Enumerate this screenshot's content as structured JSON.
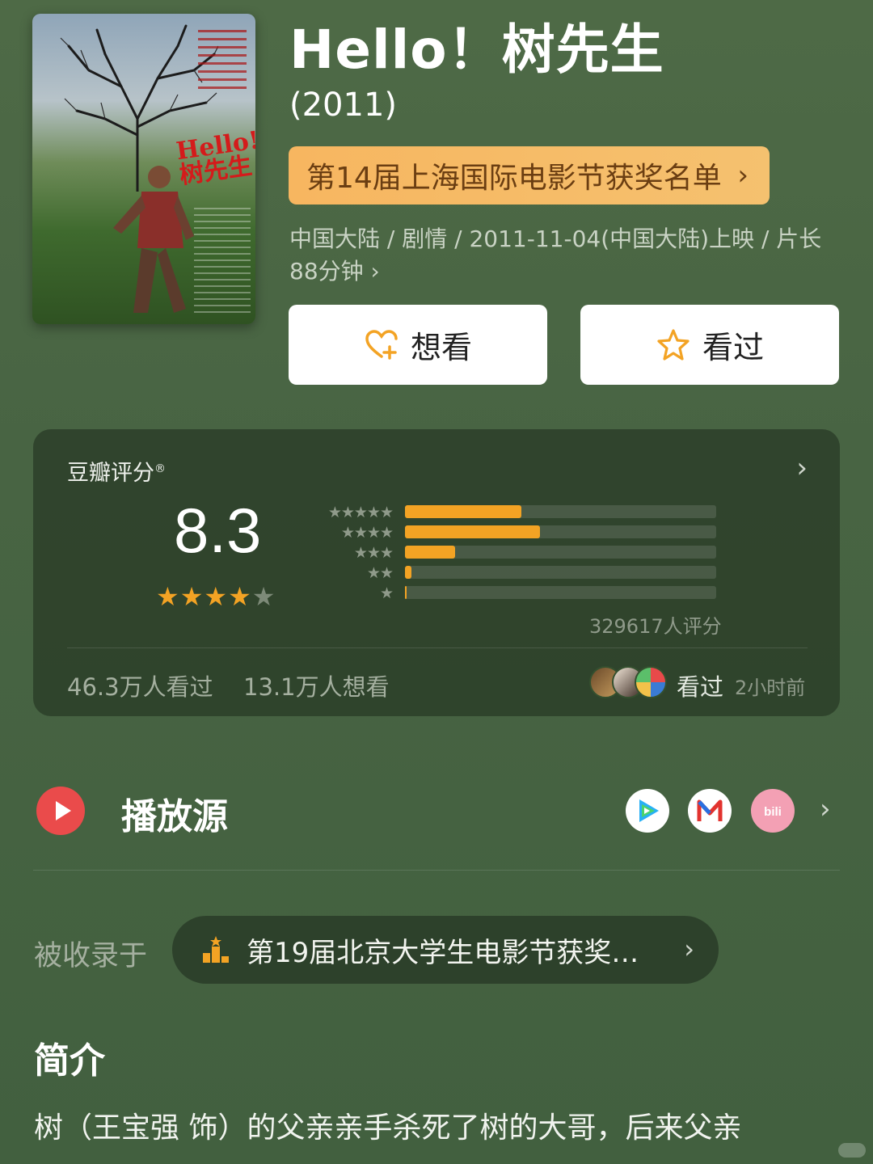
{
  "movie": {
    "title": "Hello！树先生",
    "year": "(2011)",
    "award_pill": "第14届上海国际电影节获奖名单",
    "meta": "中国大陆 / 剧情 / 2011-11-04(中国大陆)上映 / 片长88分钟 ›",
    "poster": {
      "title_art": "Hello! 树先生",
      "release_note": "11月4日 树先生 大显神通",
      "subtitle": "Mr. Tree"
    }
  },
  "actions": {
    "want_label": "想看",
    "seen_label": "看过"
  },
  "rating": {
    "label": "豆瓣评分",
    "reg_mark": "®",
    "score": "8.3",
    "stars": 4,
    "distribution": [
      {
        "stars": "★★★★★",
        "pct": 37.5
      },
      {
        "stars": "★★★★",
        "pct": 43.5
      },
      {
        "stars": "★★★",
        "pct": 16.0
      },
      {
        "stars": "★★",
        "pct": 2.0
      },
      {
        "stars": "★",
        "pct": 0.6
      }
    ],
    "count": "329617人评分",
    "watched": "46.3万人看过",
    "wishing": "13.1万人想看",
    "friend_action": "看过",
    "friend_time": "2小时前"
  },
  "play": {
    "label": "播放源",
    "sources": [
      "tencent-video-icon",
      "mango-tv-icon",
      "bilibili-icon"
    ]
  },
  "collected": {
    "label": "被收录于",
    "list_name": "第19届北京大学生电影节获奖…"
  },
  "intro": {
    "title": "简介",
    "text": "树（王宝强 饰）的父亲亲手杀死了树的大哥，后来父亲"
  },
  "colors": {
    "background": "#486443",
    "accent_orange": "#f3a324",
    "award_pill": "#f7b660",
    "play_red": "#ea4b4b"
  }
}
